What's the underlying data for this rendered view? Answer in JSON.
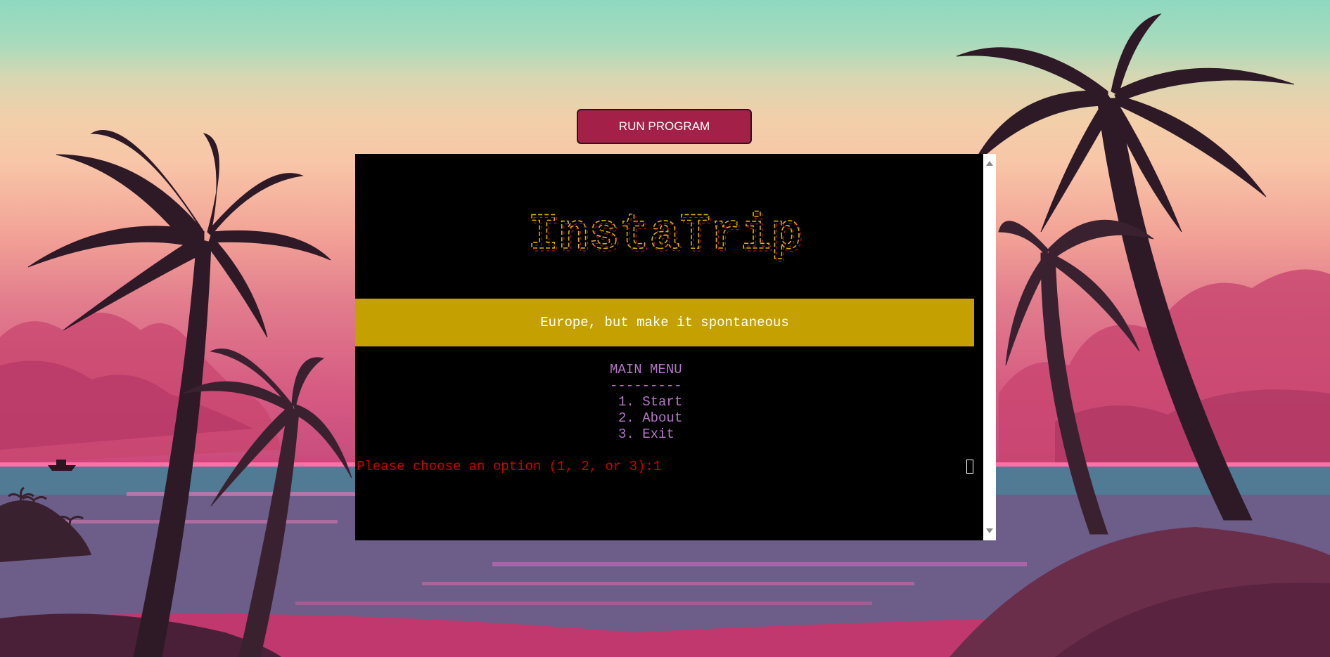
{
  "run_button": {
    "label": "RUN PROGRAM"
  },
  "terminal": {
    "logo_text": "InstaTrip",
    "tagline": "Europe, but make it spontaneous",
    "menu": {
      "title": "MAIN MENU",
      "divider": "---------",
      "options": [
        "1. Start",
        "2. About",
        "3. Exit"
      ]
    },
    "prompt": "Please choose an option (1, 2, or 3):1"
  },
  "colors": {
    "button_bg": "#a32149",
    "terminal_bg": "#000000",
    "banner_bg": "#c4a000",
    "menu_text": "#b477c4",
    "prompt_text": "#cc0000",
    "logo_yellow": "#d8b400",
    "logo_red": "#cc1a1a"
  },
  "icons": [
    "palm-tree-icon",
    "boat-icon",
    "scroll-up-icon",
    "scroll-down-icon",
    "cursor-icon"
  ]
}
